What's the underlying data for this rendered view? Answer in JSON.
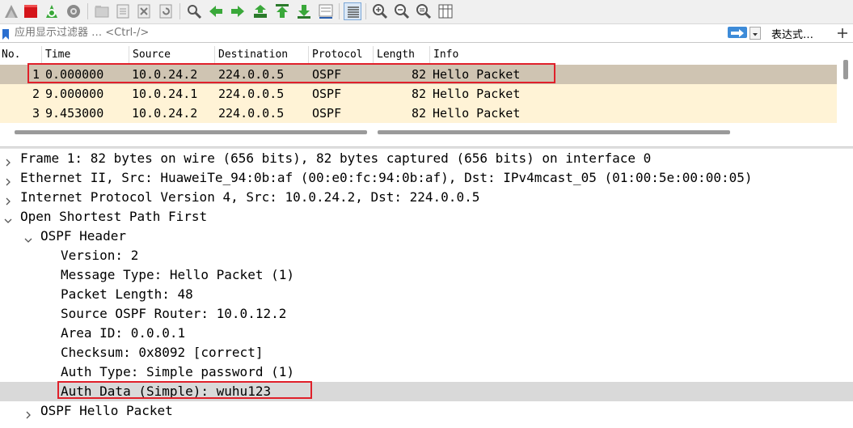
{
  "toolbar": {
    "buttons": [
      {
        "name": "start-capture-icon"
      },
      {
        "name": "stop-capture-icon"
      },
      {
        "name": "restart-capture-icon"
      },
      {
        "name": "capture-options-icon"
      },
      {
        "name": "open-file-icon"
      },
      {
        "name": "save-file-icon"
      },
      {
        "name": "close-file-icon"
      },
      {
        "name": "reload-file-icon"
      },
      {
        "name": "find-packet-icon"
      },
      {
        "name": "go-back-icon"
      },
      {
        "name": "go-forward-icon"
      },
      {
        "name": "go-to-packet-icon"
      },
      {
        "name": "go-first-icon"
      },
      {
        "name": "go-last-icon"
      },
      {
        "name": "auto-scroll-icon"
      },
      {
        "name": "colorize-icon"
      },
      {
        "name": "zoom-in-icon"
      },
      {
        "name": "zoom-out-icon"
      },
      {
        "name": "normal-size-icon"
      },
      {
        "name": "resize-columns-icon"
      }
    ]
  },
  "filter": {
    "placeholder": "应用显示过滤器 … <Ctrl-/>",
    "expression_label": "表达式…",
    "plus": "+"
  },
  "packet_list": {
    "columns": [
      "No.",
      "Time",
      "Source",
      "Destination",
      "Protocol",
      "Length",
      "Info"
    ],
    "rows": [
      {
        "no": "1",
        "time": "0.000000",
        "source": "10.0.24.2",
        "destination": "224.0.0.5",
        "protocol": "OSPF",
        "length": "82",
        "info": "Hello Packet"
      },
      {
        "no": "2",
        "time": "9.000000",
        "source": "10.0.24.1",
        "destination": "224.0.0.5",
        "protocol": "OSPF",
        "length": "82",
        "info": "Hello Packet"
      },
      {
        "no": "3",
        "time": "9.453000",
        "source": "10.0.24.2",
        "destination": "224.0.0.5",
        "protocol": "OSPF",
        "length": "82",
        "info": "Hello Packet"
      }
    ],
    "selected_row": 1
  },
  "detail_tree": {
    "items": [
      {
        "text": "Frame 1: 82 bytes on wire (656 bits), 82 bytes captured (656 bits) on interface 0",
        "state": "collapsed"
      },
      {
        "text": "Ethernet II, Src: HuaweiTe_94:0b:af (00:e0:fc:94:0b:af), Dst: IPv4mcast_05 (01:00:5e:00:00:05)",
        "state": "collapsed"
      },
      {
        "text": "Internet Protocol Version 4, Src: 10.0.24.2, Dst: 224.0.0.5",
        "state": "collapsed"
      },
      {
        "text": "Open Shortest Path First",
        "state": "expanded"
      },
      {
        "text": "OSPF Header",
        "state": "expanded"
      },
      {
        "text": "Version: 2",
        "state": "leaf"
      },
      {
        "text": "Message Type: Hello Packet (1)",
        "state": "leaf"
      },
      {
        "text": "Packet Length: 48",
        "state": "leaf"
      },
      {
        "text": "Source OSPF Router: 10.0.12.2",
        "state": "leaf"
      },
      {
        "text": "Area ID: 0.0.0.1",
        "state": "leaf"
      },
      {
        "text": "Checksum: 0x8092 [correct]",
        "state": "leaf"
      },
      {
        "text": "Auth Type: Simple password (1)",
        "state": "leaf"
      },
      {
        "text": "Auth Data (Simple): wuhu123",
        "state": "leaf",
        "highlighted": true
      },
      {
        "text": "OSPF Hello Packet",
        "state": "collapsed"
      }
    ]
  },
  "colors": {
    "selected_row_bg": "#cfc4b2",
    "ospf_row_bg": "#fff3d6",
    "highlight_box": "#e0202a",
    "tree_highlight_bg": "#d9d9d9"
  }
}
